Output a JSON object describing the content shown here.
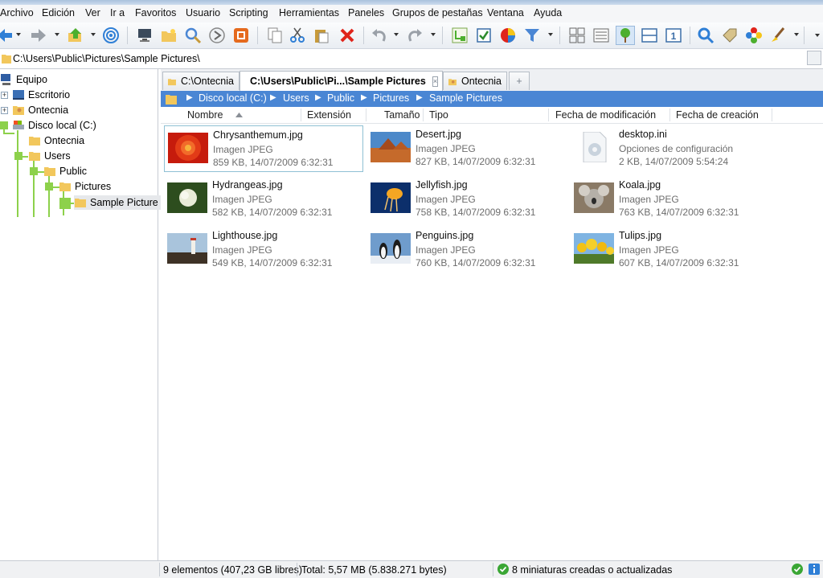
{
  "menu": [
    "Archivo",
    "Edición",
    "Ver",
    "Ir a",
    "Favoritos",
    "Usuario",
    "Scripting",
    "Herramientas",
    "Paneles",
    "Grupos de pestañas",
    "Ventana",
    "Ayuda"
  ],
  "toolbar_icons": [
    "back-arrow-icon",
    "forward-arrow-icon",
    "up-folder-icon",
    "target-icon",
    "computer-icon",
    "new-folder-icon",
    "search-icon",
    "goto-icon",
    "rename-icon",
    "copy-icon",
    "cut-icon",
    "paste-icon",
    "delete-icon",
    "undo-icon",
    "redo-icon",
    "tree-icon",
    "checkbox-icon",
    "pie-icon",
    "filter-icon",
    "view-icon",
    "details-icon",
    "green-tree-icon",
    "split-icon",
    "one-icon",
    "magnifier-icon",
    "tag-icon",
    "flower-icon",
    "brush-icon"
  ],
  "address": "C:\\Users\\Public\\Pictures\\Sample Pictures\\",
  "tree": {
    "items": [
      "Equipo",
      "Escritorio",
      "Ontecnia",
      "Disco local (C:)",
      "Ontecnia",
      "Users",
      "Public",
      "Pictures",
      "Sample Picture"
    ]
  },
  "tabs": [
    "C:\\Ontecnia",
    "C:\\Users\\Public\\Pi...\\Sample Pictures",
    "Ontecnia"
  ],
  "new_tab": "+",
  "breadcrumb": [
    "Disco local (C:)",
    "Users",
    "Public",
    "Pictures",
    "Sample Pictures"
  ],
  "columns": [
    "Nombre",
    "Extensión",
    "Tamaño",
    "Tipo",
    "Fecha de modificación",
    "Fecha de creación"
  ],
  "files": [
    {
      "name": "Chrysanthemum.jpg",
      "type": "Imagen JPEG",
      "info": "859 KB, 14/07/2009 6:32:31"
    },
    {
      "name": "Desert.jpg",
      "type": "Imagen JPEG",
      "info": "827 KB, 14/07/2009 6:32:31"
    },
    {
      "name": "desktop.ini",
      "type": "Opciones de configuración",
      "info": "2 KB, 14/07/2009 5:54:24"
    },
    {
      "name": "Hydrangeas.jpg",
      "type": "Imagen JPEG",
      "info": "582 KB, 14/07/2009 6:32:31"
    },
    {
      "name": "Jellyfish.jpg",
      "type": "Imagen JPEG",
      "info": "758 KB, 14/07/2009 6:32:31"
    },
    {
      "name": "Koala.jpg",
      "type": "Imagen JPEG",
      "info": "763 KB, 14/07/2009 6:32:31"
    },
    {
      "name": "Lighthouse.jpg",
      "type": "Imagen JPEG",
      "info": "549 KB, 14/07/2009 6:32:31"
    },
    {
      "name": "Penguins.jpg",
      "type": "Imagen JPEG",
      "info": "760 KB, 14/07/2009 6:32:31"
    },
    {
      "name": "Tulips.jpg",
      "type": "Imagen JPEG",
      "info": "607 KB, 14/07/2009 6:32:31"
    }
  ],
  "status": {
    "elements": "9 elementos (407,23 GB libres)",
    "total": "Total: 5,57 MB (5.838.271 bytes)",
    "thumbs": "8 miniaturas creadas o actualizadas"
  },
  "colors": {
    "breadcrumb_bg": "#4a86d4",
    "tree_line": "#8dd14b",
    "folder": "#f2c75c",
    "selection_border": "#8fc0d4"
  }
}
